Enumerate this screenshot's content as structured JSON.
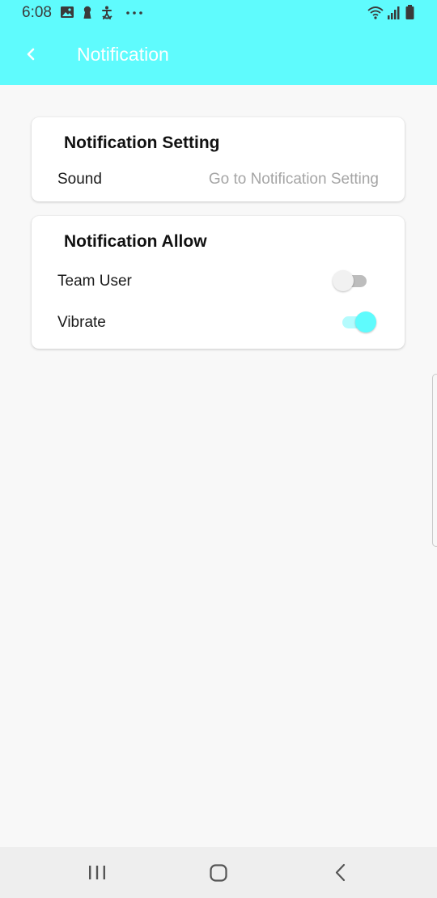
{
  "status_bar": {
    "time": "6:08",
    "left_icons": [
      "gallery-icon",
      "keyhole-icon",
      "accessibility-icon",
      "more-dots-icon"
    ],
    "right_icons": [
      "wifi-icon",
      "signal-icon",
      "battery-icon"
    ]
  },
  "app_bar": {
    "title": "Notification",
    "back_icon": "chevron-left-icon"
  },
  "notification_setting": {
    "title": "Notification Setting",
    "sound_label": "Sound",
    "sound_link": "Go to Notification Setting"
  },
  "notification_allow": {
    "title": "Notification Allow",
    "items": [
      {
        "label": "Team User",
        "enabled": false
      },
      {
        "label": "Vibrate",
        "enabled": true
      }
    ]
  },
  "nav_bar": {
    "icons": [
      "recent-apps-icon",
      "home-icon",
      "back-icon"
    ]
  },
  "colors": {
    "accent": "#5ffbfd",
    "accent_light": "#b4fbfd",
    "background": "#f8f8f8",
    "muted_text": "#a5a5a5"
  }
}
